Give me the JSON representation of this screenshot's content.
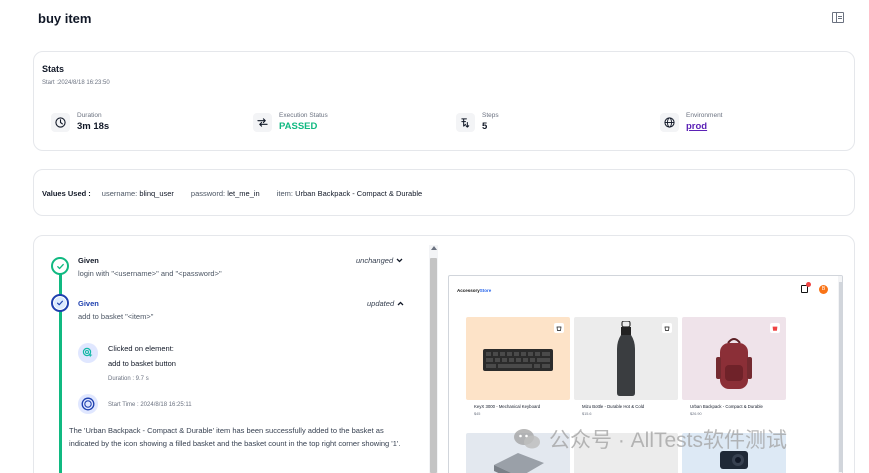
{
  "page": {
    "title": "buy item",
    "layout_toggle_icon": "sidebar-layout-icon"
  },
  "stats": {
    "title": "Stats",
    "start": "Start :2024/8/18 16:23:50",
    "items": [
      {
        "label": "Duration",
        "value": "3m 18s",
        "icon": "clock-icon"
      },
      {
        "label": "Execution Status",
        "value": "PASSED",
        "icon": "arrows-icon",
        "color": "#10b981"
      },
      {
        "label": "Steps",
        "value": "5",
        "icon": "steps-icon"
      },
      {
        "label": "Environment",
        "value": "prod",
        "icon": "globe-icon",
        "color": "#5b21b6"
      }
    ]
  },
  "values_used": {
    "label": "Values Used :",
    "params": [
      {
        "key": "username:",
        "value": "blinq_user"
      },
      {
        "key": "password:",
        "value": "let_me_in"
      },
      {
        "key": "item:",
        "value": "Urban Backpack - Compact & Durable"
      }
    ]
  },
  "steps": [
    {
      "keyword": "Given",
      "text": "login with \"<username>\" and \"<password>\"",
      "state": "unchanged",
      "keyword_color": "#111827"
    },
    {
      "keyword": "Given",
      "text": "add to basket \"<item>\"",
      "state": "updated",
      "keyword_color": "#1e40af"
    }
  ],
  "action": {
    "title": "Clicked on element:",
    "target": "add to basket button",
    "duration": "Duration : 9.7 s",
    "start_time": "Start Time : 2024/8/18 16:25:11",
    "result": "The 'Urban Backpack - Compact & Durable' item has been successfully added to the basket as indicated by the icon showing a filled basket and the basket count in the top right corner showing '1'."
  },
  "screenshot": {
    "logo_a": "Accessory",
    "logo_b": "Store",
    "avatar": "B",
    "products": [
      {
        "name": "KeyX 3000 - Mechanical Keyboard",
        "price": "$45",
        "bg": "#fde3c8"
      },
      {
        "name": "Mizu Bottle - Durable Hot & Cold",
        "price": "$15.6",
        "bg": "#ececec"
      },
      {
        "name": "Urban Backpack - Compact & Durable",
        "price": "$26.90",
        "bg": "#efe3ea"
      }
    ],
    "row2": [
      {
        "bg": "#e3e8ef"
      },
      {
        "bg": "#ececec"
      },
      {
        "bg": "#dde9f5"
      }
    ]
  },
  "watermark": {
    "text": "公众号 · AllTests软件测试"
  }
}
